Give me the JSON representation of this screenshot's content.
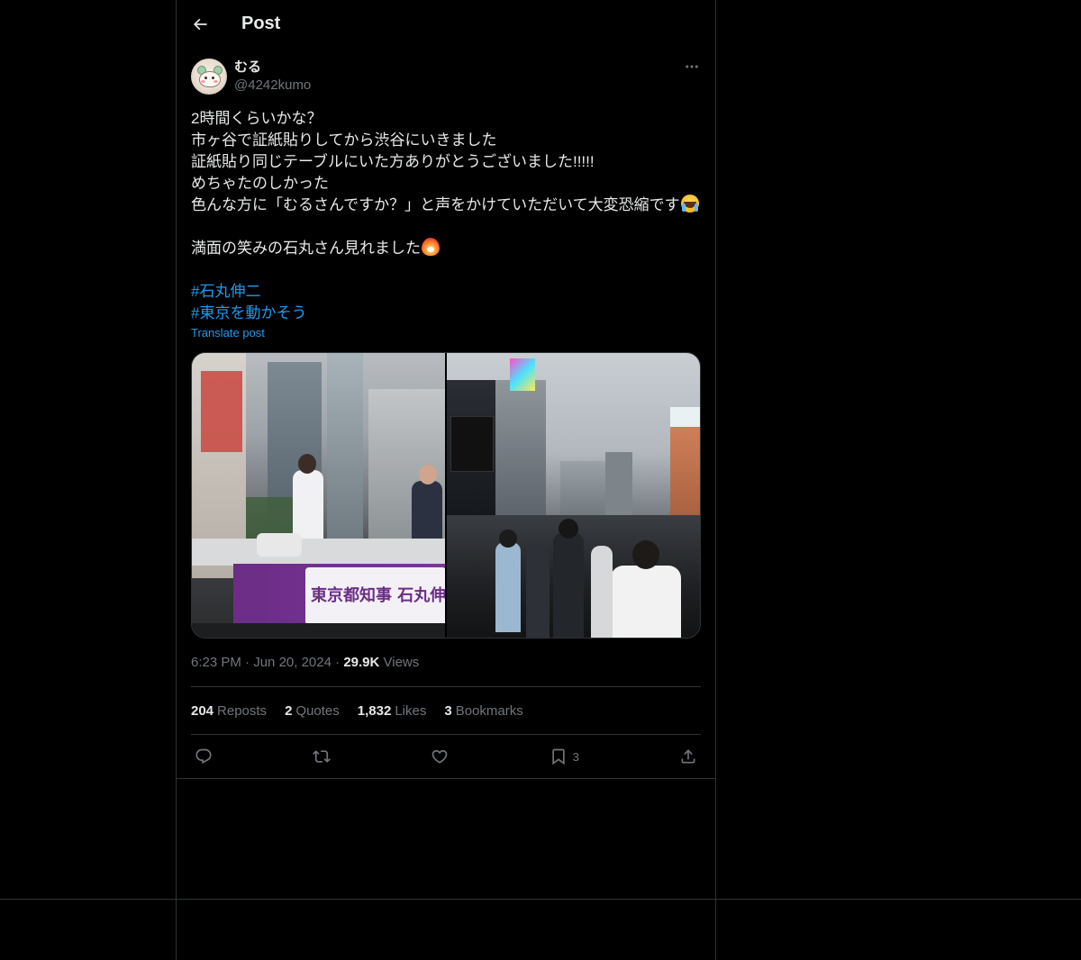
{
  "header": {
    "title": "Post"
  },
  "post": {
    "author": {
      "display_name": "むる",
      "handle": "@4242kumo"
    },
    "lines": [
      "2時間くらいかな？",
      "市ヶ谷で証紙貼りしてから渋谷にいきました",
      "証紙貼り同じテーブルにいた方ありがとうございました!!!!!",
      "めちゃたのしかった",
      "色んな方に「むるさんですか？」と声をかけていただいて大変恐縮です",
      "満面の笑みの石丸さん見れました"
    ],
    "hashtags": [
      "#石丸伸二",
      "#東京を動かそう"
    ],
    "translate_label": "Translate post",
    "time": "6:23 PM",
    "date": "Jun 20, 2024",
    "views_count": "29.9K",
    "views_label": "Views",
    "emoji": [
      "crying-face",
      "fire-heart"
    ],
    "images": [
      {
        "name": "photo-campaign-truck",
        "signboard_text": "東京都知事 石丸伸二"
      },
      {
        "name": "photo-shibuya-crowd"
      }
    ]
  },
  "stats": {
    "reposts_count": "204",
    "reposts_label": "Reposts",
    "quotes_count": "2",
    "quotes_label": "Quotes",
    "likes_count": "1,832",
    "likes_label": "Likes",
    "bookmarks_count": "3",
    "bookmarks_label": "Bookmarks"
  },
  "actions": {
    "bookmark_count": "3"
  },
  "colors": {
    "background": "#000000",
    "text_primary": "#e7e9ea",
    "text_secondary": "#71767b",
    "accent": "#1d9bf0",
    "border": "#2f3336"
  }
}
